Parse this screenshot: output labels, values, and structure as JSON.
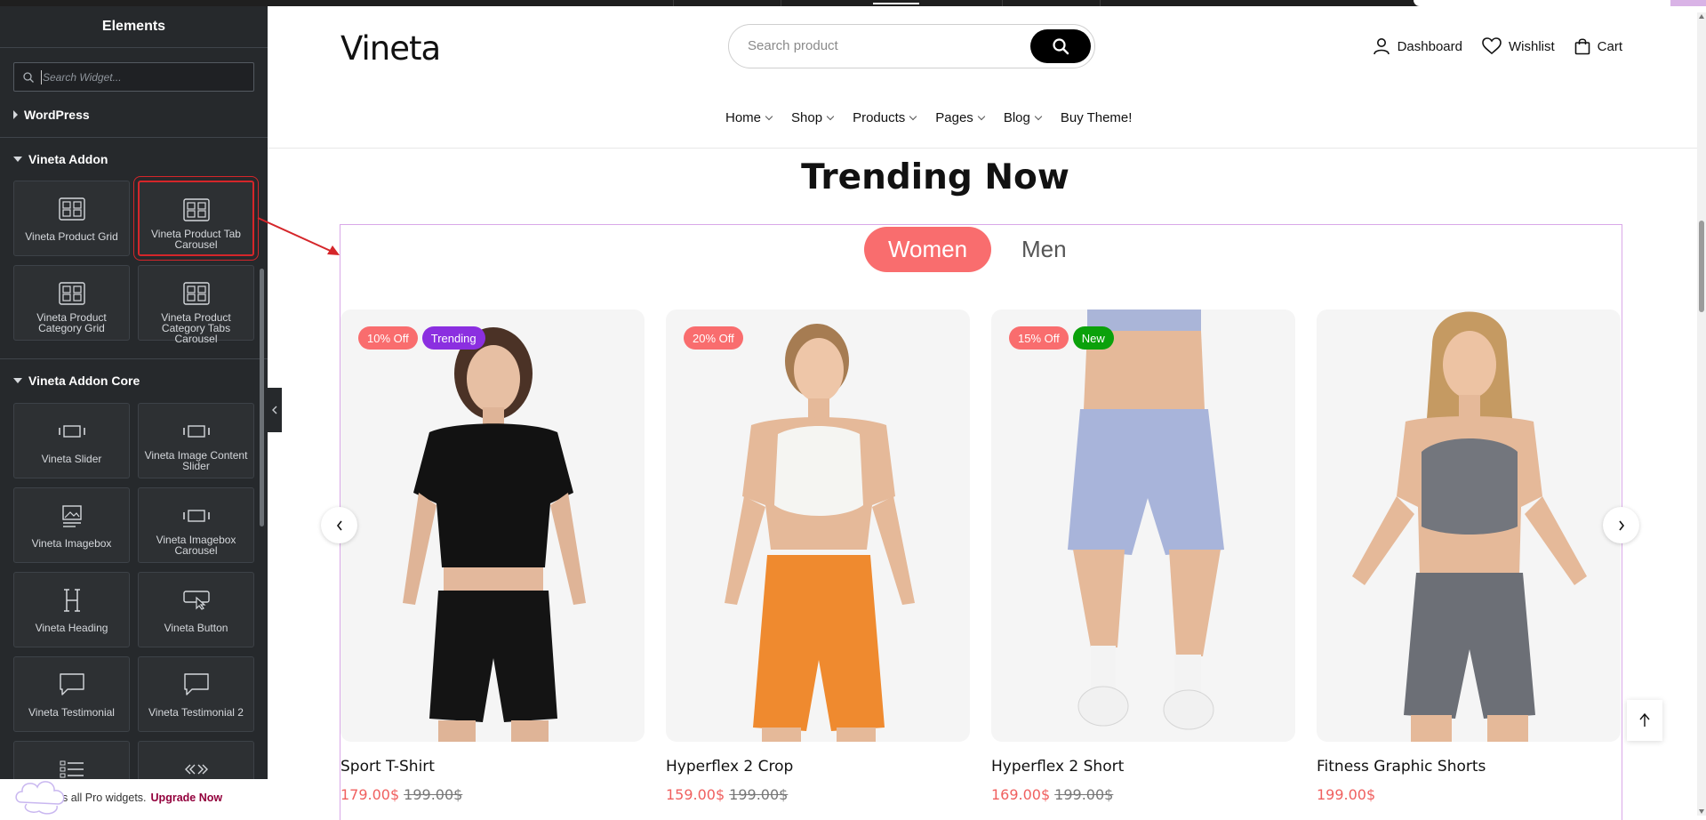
{
  "editor": {
    "title": "Elements",
    "search_placeholder": "Search Widget...",
    "categories": [
      {
        "label": "WordPress",
        "expanded": false
      },
      {
        "label": "Vineta Addon",
        "expanded": true
      },
      {
        "label": "Vineta Addon Core",
        "expanded": true
      }
    ],
    "addon_widgets": [
      {
        "label": "Vineta Product Grid",
        "icon": "grid-widget-icon"
      },
      {
        "label": "Vineta Product Tab Carousel",
        "icon": "grid-widget-icon",
        "selected": true
      },
      {
        "label": "Vineta Product Category Grid",
        "icon": "grid-widget-icon"
      },
      {
        "label": "Vineta Product Category Tabs Carousel",
        "icon": "grid-widget-icon"
      }
    ],
    "core_widgets": [
      {
        "label": "Vineta Slider",
        "icon": "slider-icon"
      },
      {
        "label": "Vineta Image Content Slider",
        "icon": "slider-icon"
      },
      {
        "label": "Vineta Imagebox",
        "icon": "image-icon"
      },
      {
        "label": "Vineta Imagebox Carousel",
        "icon": "slider-icon"
      },
      {
        "label": "Vineta Heading",
        "icon": "heading-icon"
      },
      {
        "label": "Vineta Button",
        "icon": "button-icon"
      },
      {
        "label": "Vineta Testimonial",
        "icon": "comment-icon"
      },
      {
        "label": "Vineta Testimonial 2",
        "icon": "comment-icon"
      }
    ],
    "upgrade": {
      "text": "Access all Pro widgets.",
      "link": "Upgrade Now"
    }
  },
  "site": {
    "logo": "Vineta",
    "search_placeholder": "Search product",
    "header_links": [
      "Dashboard",
      "Wishlist",
      "Cart"
    ],
    "nav": [
      "Home",
      "Shop",
      "Products",
      "Pages",
      "Blog",
      "Buy Theme!"
    ],
    "section_title": "Trending Now",
    "tabs": [
      "Women",
      "Men"
    ],
    "active_tab": "Women",
    "products": [
      {
        "name": "Sport T-Shirt",
        "price": "179.00$",
        "old_price": "199.00$",
        "badges": [
          "10% Off",
          "Trending"
        ]
      },
      {
        "name": "Hyperflex 2 Crop",
        "price": "159.00$",
        "old_price": "199.00$",
        "badges": [
          "20% Off"
        ]
      },
      {
        "name": "Hyperflex 2 Short",
        "price": "169.00$",
        "old_price": "199.00$",
        "badges": [
          "15% Off",
          "New"
        ]
      },
      {
        "name": "Fitness Graphic Shorts",
        "price": "199.00$",
        "old_price": "",
        "badges": []
      }
    ]
  },
  "colors": {
    "accent": "#f96d6e",
    "trending": "#8b2fe0",
    "new": "#0ba10b",
    "editor_bg": "#26292c",
    "selection": "#d5262a"
  }
}
